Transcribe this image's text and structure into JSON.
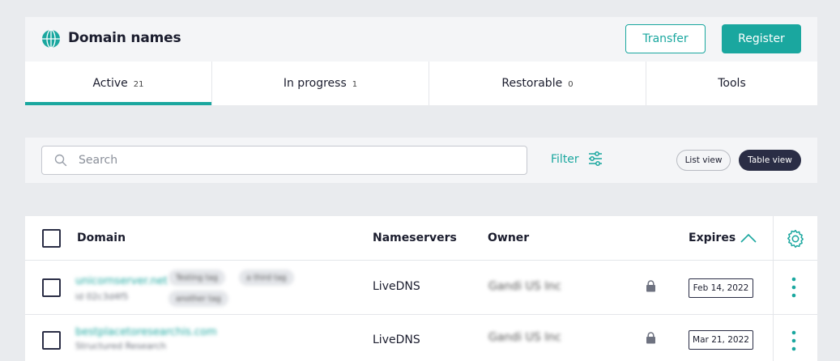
{
  "header": {
    "title": "Domain names",
    "transfer_label": "Transfer",
    "register_label": "Register",
    "icon": "globe-icon"
  },
  "tabs": [
    {
      "label": "Active",
      "count": "21",
      "active": true
    },
    {
      "label": "In progress",
      "count": "1",
      "active": false
    },
    {
      "label": "Restorable",
      "count": "0",
      "active": false
    },
    {
      "label": "Tools",
      "count": "",
      "active": false
    }
  ],
  "toolbar": {
    "search_placeholder": "Search",
    "filter_label": "Filter",
    "list_view_label": "List view",
    "table_view_label": "Table view"
  },
  "table": {
    "columns": {
      "domain": "Domain",
      "nameservers": "Nameservers",
      "owner": "Owner",
      "expires": "Expires"
    },
    "rows": [
      {
        "domain": "unicornserver.net",
        "sub": "id 02c3d4f5",
        "tags": [
          "Testing tag",
          "a third tag",
          "another tag"
        ],
        "nameservers": "LiveDNS",
        "owner": "Gandi US Inc",
        "expires": "Feb 14, 2022"
      },
      {
        "domain": "bestplacetoresearchis.com",
        "sub": "Structured Research",
        "tags": [],
        "nameservers": "LiveDNS",
        "owner": "Gandi US Inc",
        "expires": "Mar 21, 2022"
      }
    ]
  },
  "colors": {
    "accent": "#1aa79f",
    "dark": "#2a2d45",
    "background": "#e9ebee"
  }
}
